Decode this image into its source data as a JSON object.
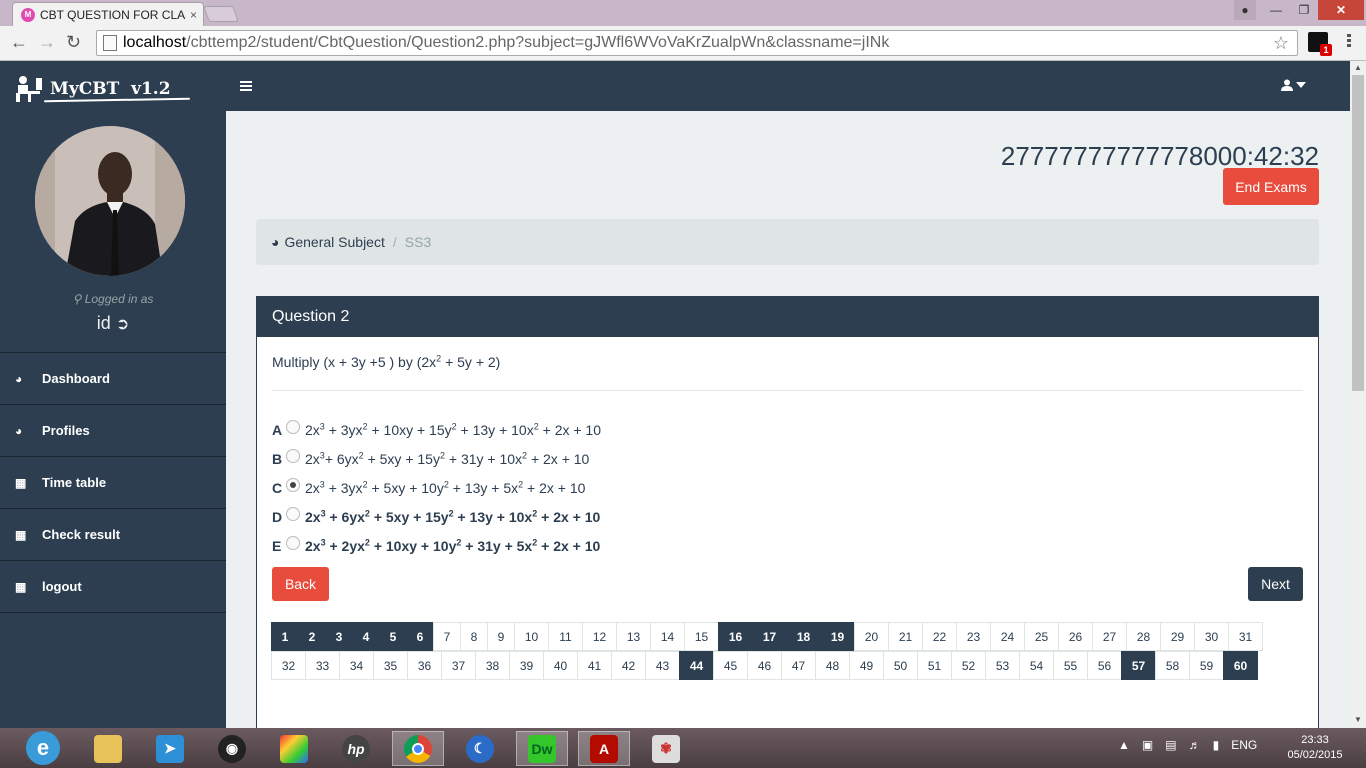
{
  "browser": {
    "tab_title": "CBT QUESTION FOR CLAS",
    "tab_close": "×",
    "url_host": "localhost",
    "url_path": "/cbttemp2/student/CbtQuestion/Question2.php?subject=gJWfl6WVoVaKrZualpWn&classname=jINk",
    "ext_badge": "1"
  },
  "app": {
    "brand": "MyCBT  v1.2",
    "logged_in_label": "Logged in as",
    "user_id": "id",
    "sidebar_items": [
      {
        "label": "Dashboard",
        "icon": "dashboard-icon"
      },
      {
        "label": "Profiles",
        "icon": "dashboard-icon"
      },
      {
        "label": "Time table",
        "icon": "calendar-icon"
      },
      {
        "label": "Check result",
        "icon": "calendar-icon"
      },
      {
        "label": "logout",
        "icon": "calendar-icon"
      }
    ]
  },
  "exam": {
    "timer": "27777777777778000:42:32",
    "end_button": "End Exams",
    "breadcrumb_subject": "General Subject",
    "breadcrumb_sep": "/",
    "breadcrumb_class": "SS3",
    "question_title": "Question 2",
    "question_parts": [
      "Multiply (x + 3y +5 ) by (2x",
      "2",
      " + 5y + 2)"
    ],
    "options": [
      {
        "letter": "A",
        "checked": false,
        "bold": false,
        "terms": [
          "2x",
          "3",
          " + 3yx",
          "2",
          " + 10xy + 15y",
          "2",
          " + 13y + 10x",
          "2",
          " + 2x + 10"
        ]
      },
      {
        "letter": "B",
        "checked": false,
        "bold": false,
        "terms": [
          "2x",
          "3",
          "+ 6yx",
          "2",
          " + 5xy + 15y",
          "2",
          " + 31y + 10x",
          "2",
          " + 2x + 10"
        ]
      },
      {
        "letter": "C",
        "checked": true,
        "bold": false,
        "terms": [
          "2x",
          "3",
          " + 3yx",
          "2",
          " + 5xy + 10y",
          "2",
          " + 13y + 5x",
          "2",
          " + 2x + 10"
        ]
      },
      {
        "letter": "D",
        "checked": false,
        "bold": true,
        "terms": [
          "2x",
          "3",
          " + 6yx",
          "2",
          " + 5xy + 15y",
          "2",
          " + 13y + 10x",
          "2",
          " + 2x + 10"
        ]
      },
      {
        "letter": "E",
        "checked": false,
        "bold": true,
        "terms": [
          "2x",
          "3",
          " + 2yx",
          "2",
          " + 10xy + 10y",
          "2",
          " + 31y + 5x",
          "2",
          " + 2x + 10"
        ]
      }
    ],
    "back_button": "Back",
    "next_button": "Next",
    "pages_row1": [
      "1",
      "2",
      "3",
      "4",
      "5",
      "6",
      "7",
      "8",
      "9",
      "10",
      "11",
      "12",
      "13",
      "14",
      "15",
      "16",
      "17",
      "18",
      "19",
      "20",
      "21",
      "22",
      "23",
      "24",
      "25",
      "26",
      "27",
      "28",
      "29",
      "30",
      "31"
    ],
    "pages_row2": [
      "32",
      "33",
      "34",
      "35",
      "36",
      "37",
      "38",
      "39",
      "40",
      "41",
      "42",
      "43",
      "44",
      "45",
      "46",
      "47",
      "48",
      "49",
      "50",
      "51",
      "52",
      "53",
      "54",
      "55",
      "56",
      "57",
      "58",
      "59",
      "60"
    ],
    "answered": [
      "1",
      "2",
      "3",
      "4",
      "5",
      "6",
      "16",
      "17",
      "18",
      "19",
      "44",
      "57",
      "60"
    ]
  },
  "taskbar": {
    "apps": [
      "explorer",
      "file-explorer",
      "rocket",
      "media-player",
      "puzzle",
      "hp",
      "chrome",
      "moon-app",
      "dreamweaver",
      "acrobat",
      "paint"
    ],
    "language": "ENG",
    "time": "23:33",
    "date": "05/02/2015"
  },
  "colors": {
    "primary": "#2c3e50",
    "danger": "#e74c3c",
    "background": "#ecf0f1"
  }
}
